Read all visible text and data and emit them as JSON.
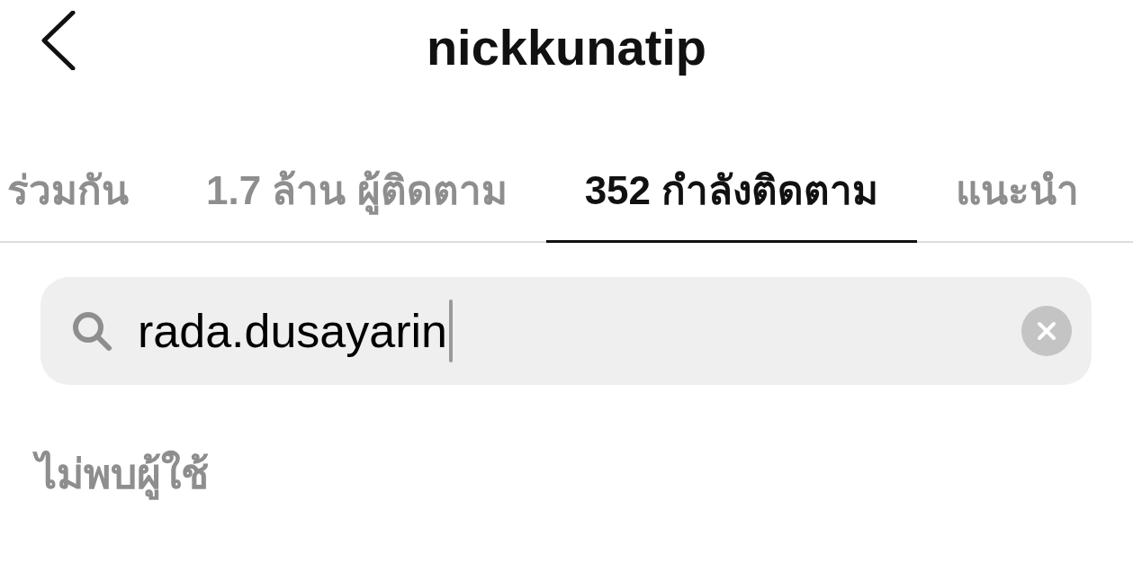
{
  "header": {
    "title": "nickkunatip"
  },
  "tabs": [
    {
      "label": "ร่วมกัน",
      "selected": false
    },
    {
      "label": "1.7 ล้าน ผู้ติดตาม",
      "selected": false
    },
    {
      "label": "352 กำลังติดตาม",
      "selected": true
    },
    {
      "label": "แนะนำ",
      "selected": false
    }
  ],
  "search": {
    "value": "rada.dusayarin",
    "focused": true
  },
  "message": "ไม่พบผู้ใช้"
}
